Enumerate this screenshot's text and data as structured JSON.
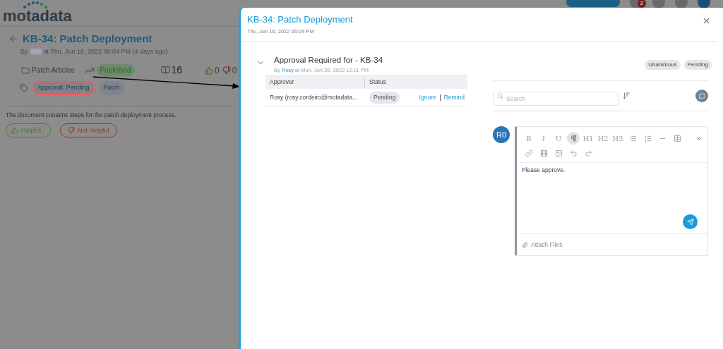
{
  "app": {
    "logo": "motadata",
    "notification_count": "2"
  },
  "article": {
    "title": "KB-34: Patch Deployment",
    "byline_prefix": "By",
    "byline_suffix": "at Thu, Jun 16, 2022 06:04 PM (4 days ago)",
    "category": "Patch Articles",
    "status": "Published",
    "views": "16",
    "likes": "0",
    "dislikes": "0",
    "tags": [
      {
        "label": "Approval: Pending",
        "highlighted": true
      },
      {
        "label": "Patch",
        "highlighted": false
      }
    ],
    "description": "The document contains steps for the patch deployment process.",
    "feedback": [
      {
        "label": "Helpful",
        "kind": "positive"
      },
      {
        "label": "Not Helpful",
        "kind": "negative"
      }
    ]
  },
  "drawer": {
    "title": "KB-34: Patch Deployment",
    "date": "Thu, Jun 16, 2022 06:04 PM",
    "approval": {
      "expanded": true,
      "title": "Approval Required for - KB-34",
      "by_prefix": "By",
      "author": "Rosy",
      "at": "at Mon, Jun 20, 2022 12:11 PM",
      "badges": [
        "Unanimous",
        "Pending"
      ],
      "columns": [
        "Approver",
        "Status"
      ],
      "rows": [
        {
          "approver": "Rosy (rosy.cordeiro@motadata...",
          "status": "Pending",
          "actions": [
            "Ignore",
            "Remind"
          ]
        }
      ]
    },
    "search": {
      "placeholder": "Search"
    },
    "comment": {
      "avatar": "R0",
      "text": "Please approve.",
      "attach": "Attach Files",
      "toolbar": [
        {
          "kind": "letter",
          "label": "B",
          "selected": false
        },
        {
          "kind": "letter",
          "label": "I",
          "selected": false
        },
        {
          "kind": "letter",
          "label": "U",
          "selected": false
        },
        {
          "kind": "paragraph",
          "selected": true
        },
        {
          "kind": "letter",
          "label": "H1",
          "selected": false
        },
        {
          "kind": "letter",
          "label": "H2",
          "selected": false
        },
        {
          "kind": "letter",
          "label": "H3",
          "selected": false
        },
        {
          "kind": "bullets",
          "selected": false
        },
        {
          "kind": "numbers",
          "selected": false
        },
        {
          "kind": "rule",
          "selected": false
        },
        {
          "kind": "table",
          "selected": false
        },
        {
          "kind": "link",
          "selected": false
        },
        {
          "kind": "video",
          "selected": false
        },
        {
          "kind": "image",
          "selected": false
        },
        {
          "kind": "undo",
          "selected": false
        },
        {
          "kind": "redo",
          "selected": false
        }
      ]
    }
  }
}
